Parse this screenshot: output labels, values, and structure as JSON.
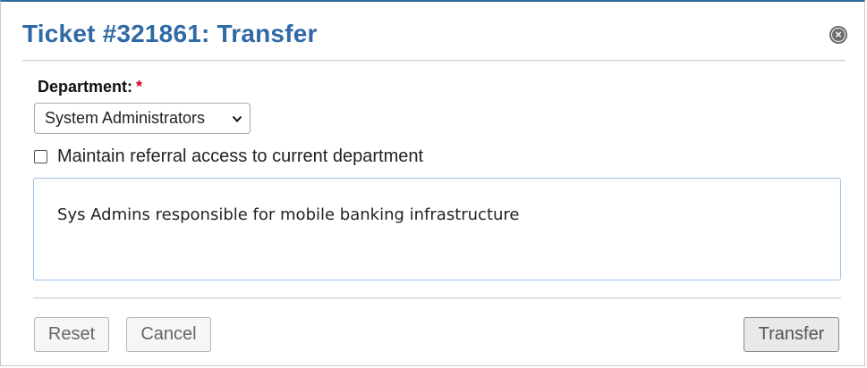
{
  "dialog": {
    "title": "Ticket #321861: Transfer",
    "close_icon": "close-circle-icon",
    "close_glyph": "×"
  },
  "form": {
    "department_label": "Department:",
    "required_marker": "*",
    "department_selected": "System Administrators",
    "referral_checkbox_label": "Maintain referral access to current department",
    "referral_checked": false,
    "comments_text": "Sys Admins responsible for mobile banking infrastructure"
  },
  "buttons": {
    "reset": "Reset",
    "cancel": "Cancel",
    "transfer": "Transfer"
  },
  "colors": {
    "title": "#2f69a6",
    "required": "#d0021b",
    "textarea_border": "#9ec2e6"
  }
}
